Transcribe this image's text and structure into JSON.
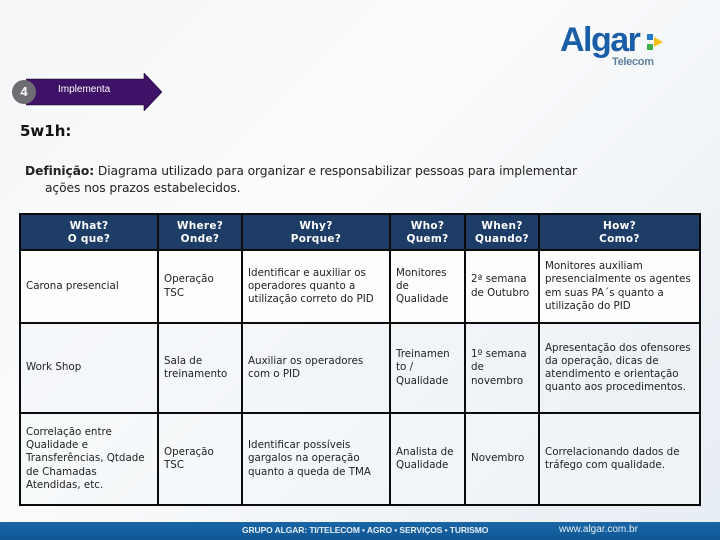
{
  "logo": {
    "wordmark": "Algar",
    "subtitle": "Telecom",
    "colors": {
      "primary": "#1b5ea8",
      "mark_blue": "#2a78c8",
      "mark_green": "#3fae49",
      "mark_yellow": "#f2c21b"
    }
  },
  "step": {
    "number": "4",
    "label": "Implementa",
    "color": "#3e1266"
  },
  "page": {
    "title": "5w1h:",
    "definition_label": "Definição:",
    "definition_text": " Diagrama utilizado para organizar e responsabilizar pessoas para  implementar",
    "definition_text_line2": "ações nos prazos estabelecidos."
  },
  "table": {
    "header_color": "#1d3c66",
    "headers": [
      {
        "en": "What?",
        "pt": "O que?"
      },
      {
        "en": "Where?",
        "pt": "Onde?"
      },
      {
        "en": "Why?",
        "pt": "Porque?"
      },
      {
        "en": "Who?",
        "pt": "Quem?"
      },
      {
        "en": "When?",
        "pt": "Quando?"
      },
      {
        "en": "How?",
        "pt": "Como?"
      }
    ],
    "rows": [
      {
        "what": "Carona presencial",
        "where": "Operação TSC",
        "why": "Identificar e auxiliar os operadores quanto a utilização correto do PID",
        "who": "Monitores de Qualidade",
        "when": "2ª semana de Outubro",
        "how": "Monitores auxiliam presencialmente os agentes em suas PA´s quanto a utilização do PID"
      },
      {
        "what": "Work Shop",
        "where": "Sala de treinamento",
        "why": "Auxiliar os operadores com o PID",
        "who": "Treinamen to / Qualidade",
        "when": "1º semana de novembro",
        "how": "Apresentação dos ofensores da operação, dicas de atendimento e orientação quanto aos procedimentos."
      },
      {
        "what": "Correlação entre Qualidade e Transferências, Qtdade de Chamadas Atendidas, etc.",
        "where": "Operação TSC",
        "why": "Identificar  possíveis gargalos na operação quanto a queda de TMA",
        "who": "Analista de Qualidade",
        "when": "Novembro",
        "how": "Correlacionando dados de tráfego com qualidade."
      }
    ]
  },
  "footer": {
    "groups": "GRUPO ALGAR: TI/TELECOM • AGRO • SERVIÇOS • TURISMO",
    "url": "www.algar.com.br",
    "color": "#1562a0"
  }
}
